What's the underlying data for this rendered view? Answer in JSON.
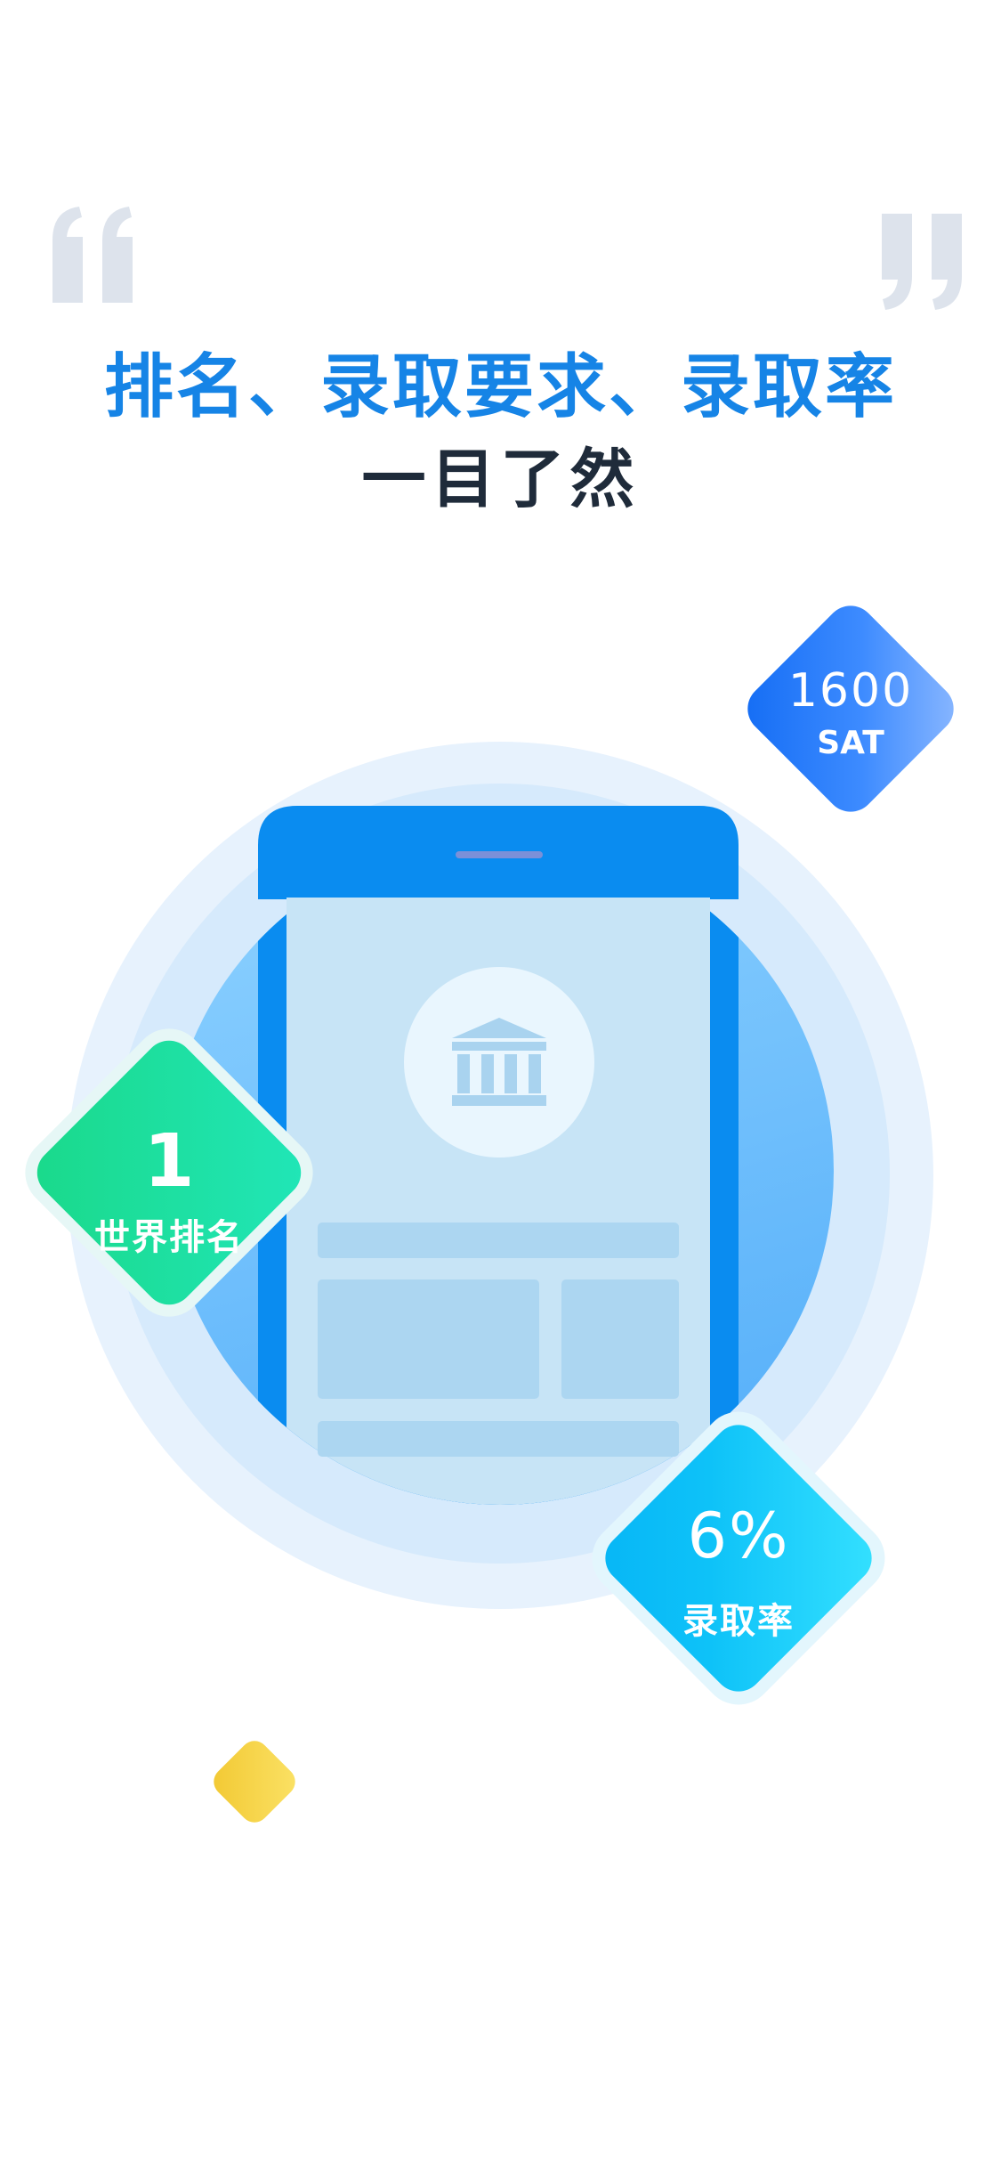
{
  "headline": {
    "title": "排名、录取要求、录取率",
    "subtitle": "一目了然"
  },
  "illustration": {
    "center_icon": "bank-icon"
  },
  "badges": {
    "sat": {
      "value": "1600",
      "label": "SAT"
    },
    "rank": {
      "value": "1",
      "label": "世界排名"
    },
    "rate": {
      "value": "6%",
      "label": "录取率"
    }
  },
  "colors": {
    "accent_blue": "#1684e6",
    "dark_text": "#1f2b3a",
    "phone_blue": "#0a8cf0",
    "green": "#1ddc9a",
    "cyan": "#12c6f8",
    "yellow": "#f5d142",
    "quote_gray": "#dde3ec"
  }
}
